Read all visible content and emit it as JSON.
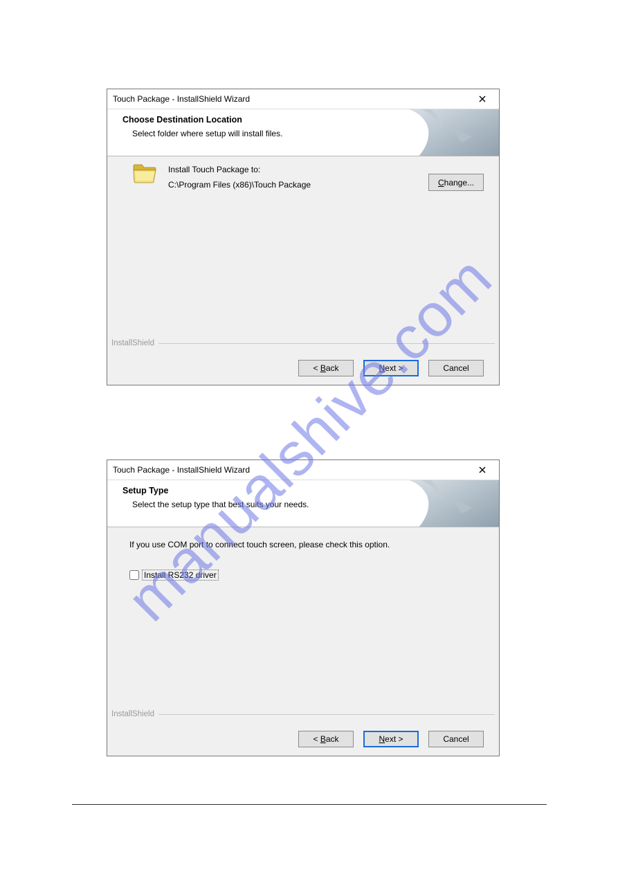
{
  "watermark": "manualshive.com",
  "dialog1": {
    "title": "Touch Package - InstallShield Wizard",
    "header_title": "Choose Destination Location",
    "header_sub": "Select folder where setup will install files.",
    "install_to_label": "Install Touch Package to:",
    "install_path": "C:\\Program Files (x86)\\Touch Package",
    "change_label": "Change...",
    "change_mnemonic": "C",
    "branding": "InstallShield",
    "back_label": "< Back",
    "back_mnemonic": "B",
    "next_label": "Next >",
    "next_mnemonic": "N",
    "cancel_label": "Cancel"
  },
  "dialog2": {
    "title": "Touch Package - InstallShield Wizard",
    "header_title": "Setup Type",
    "header_sub": "Select the setup type that best suits your needs.",
    "option_line": "If you use COM port to connect touch screen, please check this option.",
    "checkbox_label": "Install RS232 driver",
    "checkbox_checked": false,
    "branding": "InstallShield",
    "back_label": "< Back",
    "back_mnemonic": "B",
    "next_label": "Next >",
    "next_mnemonic": "N",
    "cancel_label": "Cancel"
  }
}
